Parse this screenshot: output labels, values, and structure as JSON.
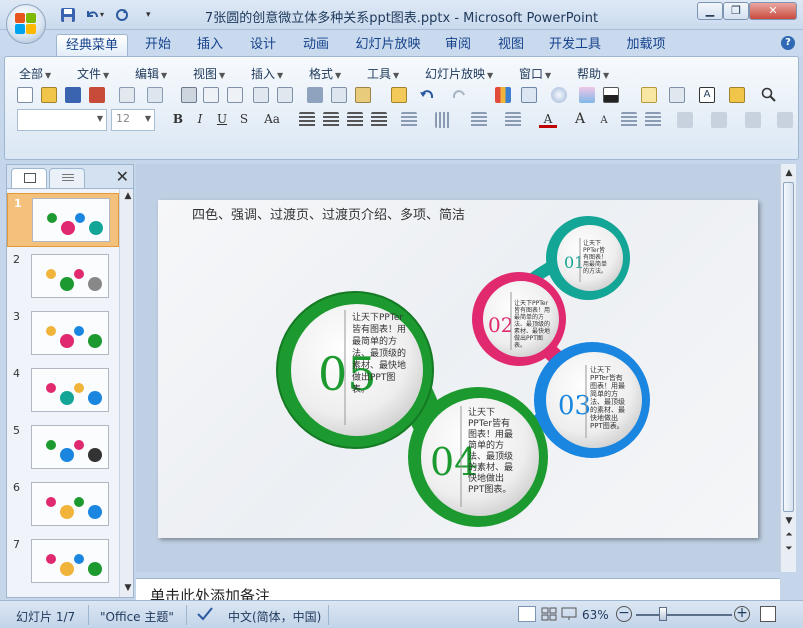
{
  "window": {
    "title": "7张圆的创意微立体多种关系ppt图表.pptx - Microsoft PowerPoint",
    "minimize_icon": "minimize-icon",
    "maximize_icon": "restore-icon",
    "close_icon": "close-icon"
  },
  "quick_access": {
    "save_icon": "save-icon",
    "undo_icon": "undo-icon",
    "redo_icon": "redo-icon",
    "customize_icon": "chevron-down-icon"
  },
  "tabs": [
    {
      "label": "经典菜单",
      "active": true
    },
    {
      "label": "开始"
    },
    {
      "label": "插入"
    },
    {
      "label": "设计"
    },
    {
      "label": "动画"
    },
    {
      "label": "幻灯片放映"
    },
    {
      "label": "审阅"
    },
    {
      "label": "视图"
    },
    {
      "label": "开发工具"
    },
    {
      "label": "加载项"
    }
  ],
  "menus": [
    "全部",
    "文件",
    "编辑",
    "视图",
    "插入",
    "格式",
    "工具",
    "幻灯片放映",
    "窗口",
    "帮助"
  ],
  "font_size_value": "12",
  "font_name_value": "",
  "slides_panel": {
    "slide_numbers": [
      "1",
      "2",
      "3",
      "4",
      "5",
      "6",
      "7"
    ],
    "selected": "1"
  },
  "slide": {
    "title": "四色、强调、过渡页、过渡页介绍、多项、简洁",
    "circles": [
      {
        "number": "05",
        "text": "让天下PPTer皆有图表！用最简单的方法、最顶级的素材、最快地做出PPT图表。",
        "color": "#1d9a2f"
      },
      {
        "number": "04",
        "text": "让天下PPTer皆有图表！用最简单的方法、最顶级的素材、最快地做出PPT图表。",
        "color": "#1d9a2f"
      },
      {
        "number": "03",
        "text": "让天下PPTer皆有图表！用最简单的方法、最顶级的素材、最快地做出PPT图表。",
        "color": "#1a86e0"
      },
      {
        "number": "02",
        "text": "让天下PPTer皆有图表！用最简单的方法、最顶级的素材、最快地做出PPT图表。",
        "color": "#e0296f"
      },
      {
        "number": "01",
        "text": "让天下PPTer皆有图表！用最简单的方法。",
        "color": "#13a595"
      }
    ]
  },
  "notes": {
    "placeholder": "单击此处添加备注"
  },
  "status_bar": {
    "slide_info": "幻灯片 1/7",
    "theme": "\"Office 主题\"",
    "language": "中文(简体，中国)",
    "zoom": "63%"
  },
  "colors": {
    "accent_green": "#1d9a2f",
    "accent_blue": "#1a86e0",
    "accent_pink": "#e0296f",
    "accent_teal": "#13a595",
    "ribbon_blue": "#c9daee"
  }
}
